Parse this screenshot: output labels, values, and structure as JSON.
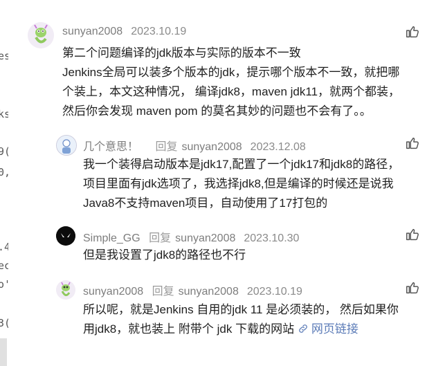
{
  "edge_fragments": [
    "es",
    "ks",
    "9(",
    "0,",
    ".4",
    "ec",
    "o'",
    "3("
  ],
  "comments": [
    {
      "author": "sunyan2008",
      "date": "2023.10.19",
      "lines": [
        "第二个问题编译的jdk版本与实际的版本不一致",
        "Jenkins全局可以装多个版本的jdk，提示哪个版本不一致，就把哪",
        "个装上，本文这种情况， 编译jdk8，maven jdk11，就两个都装，",
        "然后你会发现 maven pom 的莫名其妙的问题也不会有了。。"
      ]
    },
    {
      "author": "几个意思！",
      "reply_label": "回复",
      "reply_to": "sunyan2008",
      "date": "2023.12.08",
      "lines": [
        "我一个装得启动版本是jdk17,配置了一个jdk17和jdk8的路径，",
        "项目里面有jdk选项了，我选择jdk8,但是编译的时候还是说我",
        "Java8不支持maven项目，自动使用了17打包的"
      ]
    },
    {
      "author": "Simple_GG",
      "reply_label": "回复",
      "reply_to": "sunyan2008",
      "date": "2023.10.30",
      "lines": [
        "但是我设置了jdk8的路径也不行"
      ]
    },
    {
      "author": "sunyan2008",
      "reply_label": "回复",
      "reply_to": "sunyan2008",
      "date": "2023.10.19",
      "lines": [
        "所以呢，就是Jenkins 自用的jdk 11 是必须装的， 然后如果你",
        "用jdk8，就也装上 附带个 jdk 下载的网站"
      ],
      "link_text": "网页链接"
    }
  ],
  "icons": {
    "like": "thumbs-up-icon",
    "link": "link-icon"
  },
  "colors": {
    "meta": "#8a8a8a",
    "link": "#5b7bb7",
    "text": "#1f1f1f"
  }
}
